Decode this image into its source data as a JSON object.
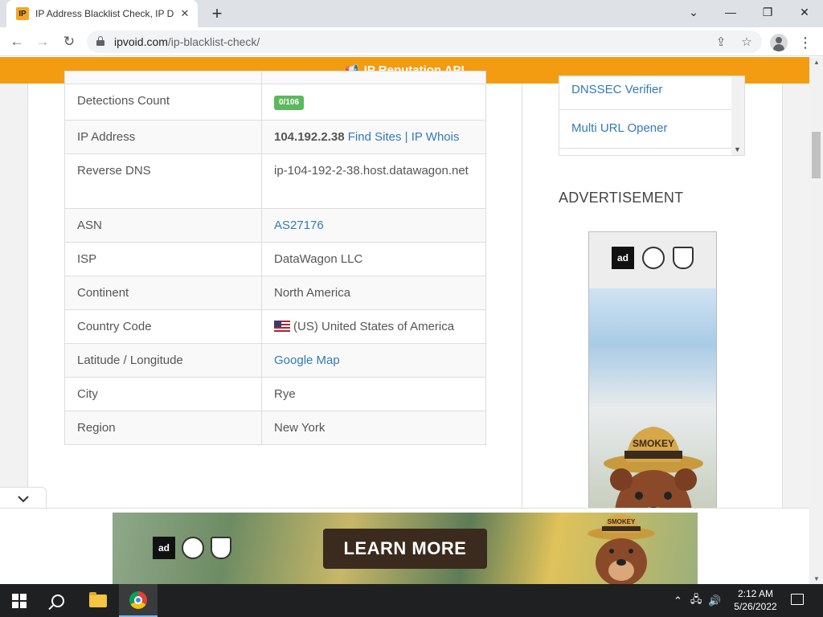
{
  "browser": {
    "tab_title": "IP Address Blacklist Check, IP DNS",
    "tab_favicon_text": "IP",
    "url_domain": "ipvoid.com",
    "url_path": "/ip-blacklist-check/"
  },
  "banner_top": {
    "label": "IP Reputation API"
  },
  "info_table": {
    "rows": [
      {
        "key": "Detections Count",
        "value": "0/106"
      },
      {
        "key": "IP Address",
        "ip": "104.192.2.38",
        "link1": "Find Sites",
        "sep": "|",
        "link2": "IP Whois"
      },
      {
        "key": "Reverse DNS",
        "value": "ip-104-192-2-38.host.datawagon.net"
      },
      {
        "key": "ASN",
        "value": "AS27176"
      },
      {
        "key": "ISP",
        "value": "DataWagon LLC"
      },
      {
        "key": "Continent",
        "value": "North America"
      },
      {
        "key": "Country Code",
        "value": "(US) United States of America"
      },
      {
        "key": "Latitude / Longitude",
        "value": "Google Map"
      },
      {
        "key": "City",
        "value": "Rye"
      },
      {
        "key": "Region",
        "value": "New York"
      }
    ]
  },
  "sidebar": {
    "tools": [
      "DNSSEC Verifier",
      "Multi URL Opener"
    ],
    "advertisement_title": "ADVERTISEMENT",
    "ad_logo_text": "ad",
    "ad_hat_text": "SMOKEY"
  },
  "bottom_ad": {
    "cta": "LEARN MORE",
    "logo_text": "ad",
    "hat_text": "SMOKEY"
  },
  "taskbar": {
    "time": "2:12 AM",
    "date": "5/26/2022"
  },
  "colors": {
    "accent_orange": "#f39c12",
    "badge_green": "#5cb85c",
    "link_blue": "#337ab7"
  }
}
